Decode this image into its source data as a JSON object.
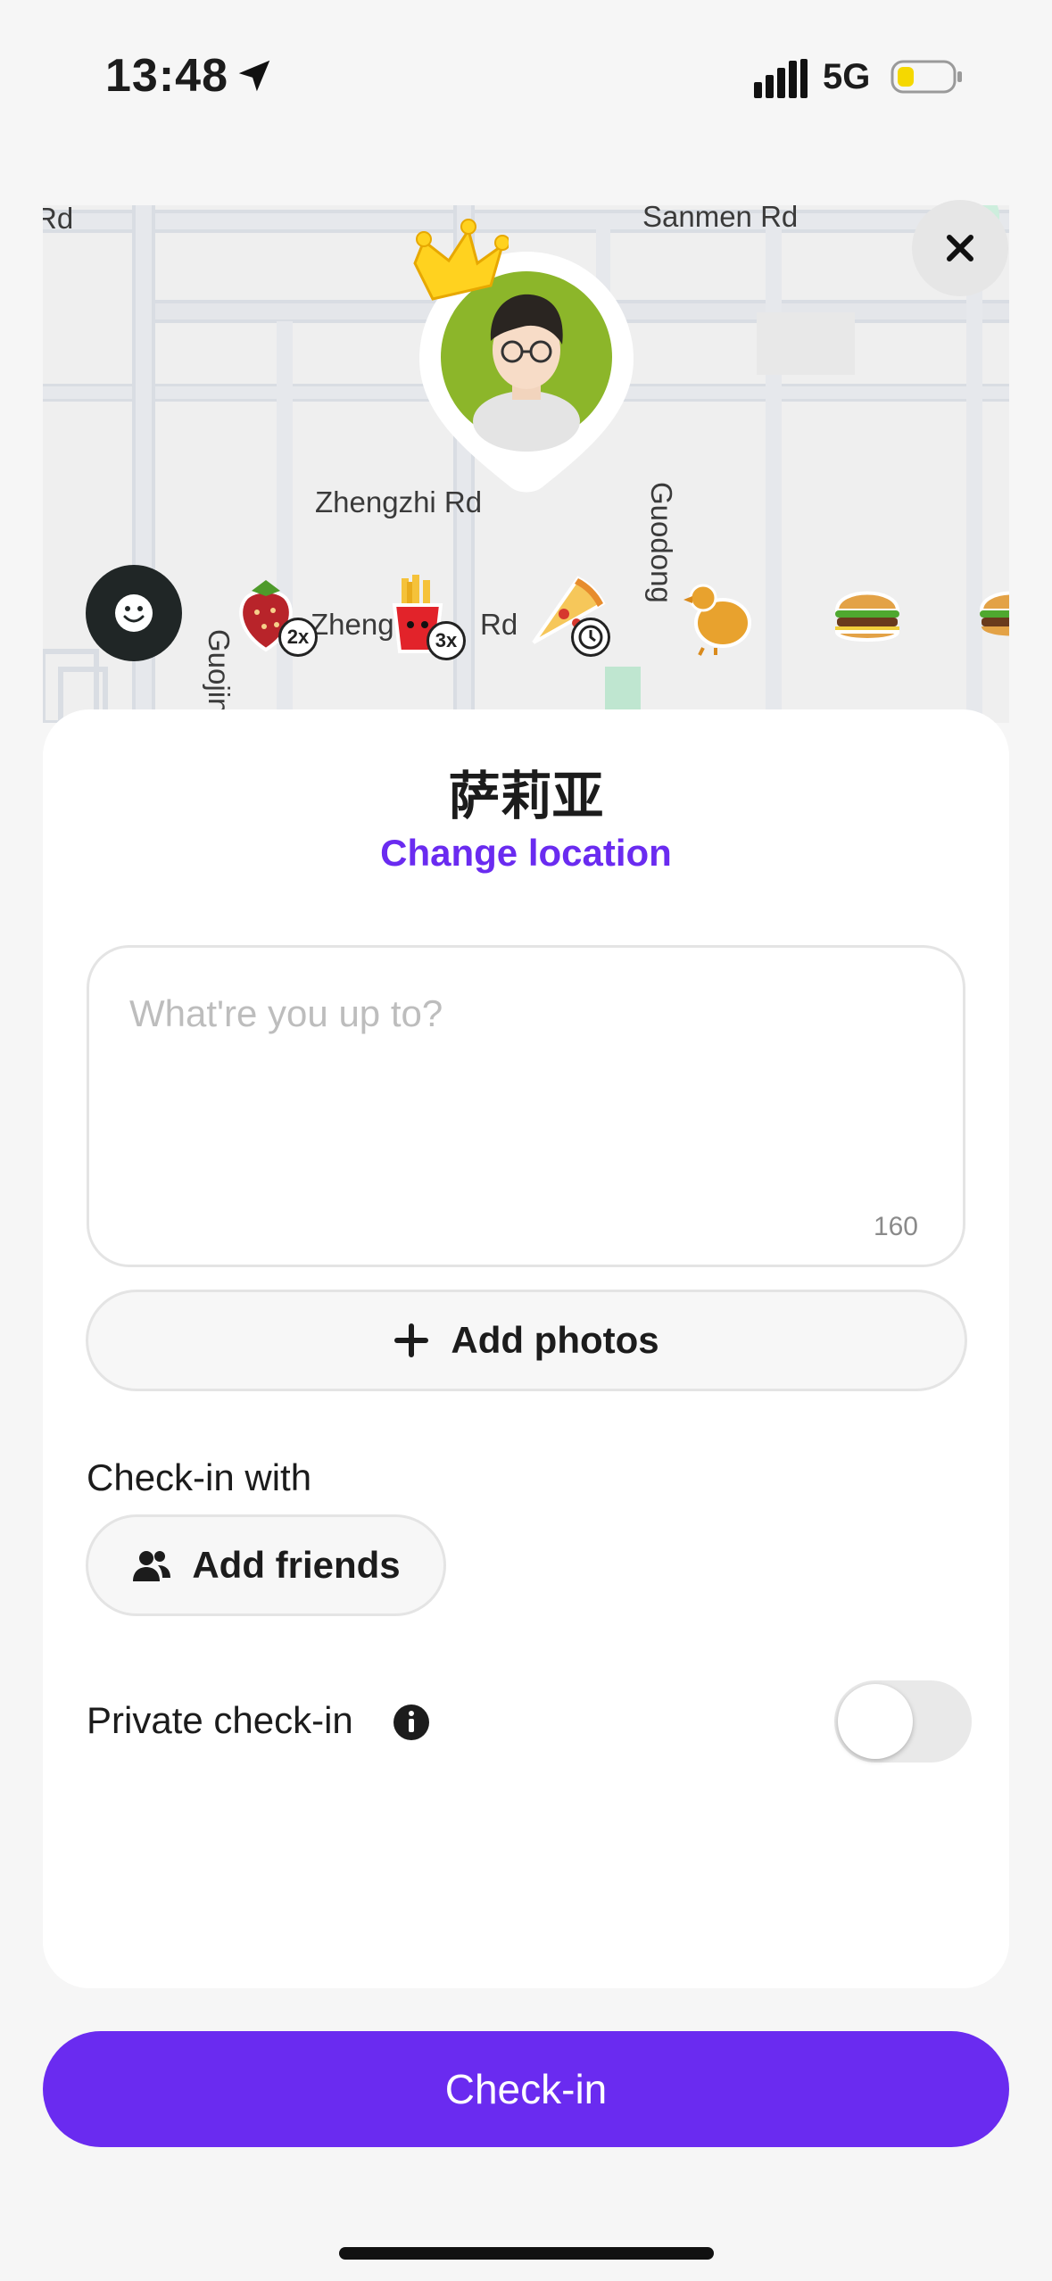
{
  "status_bar": {
    "time": "13:48",
    "network": "5G",
    "battery_color": "#f5d800"
  },
  "map": {
    "labels": {
      "rd_partial": "Rd",
      "sanmen": "Sanmen Rd",
      "zhengzhi": "Zhengzhi Rd",
      "guodong": "Guodong",
      "zheng_partial": "Zheng",
      "rd_partial2": "Rd",
      "guojin": "Guojin"
    },
    "food_items": [
      {
        "icon": "strawberry-icon",
        "badge": "2x"
      },
      {
        "icon": "fries-icon",
        "badge": "3x"
      },
      {
        "icon": "pizza-icon",
        "badge": "clock"
      },
      {
        "icon": "chicken-icon"
      },
      {
        "icon": "burger-icon"
      },
      {
        "icon": "burger-icon"
      }
    ]
  },
  "card": {
    "place_name": "萨莉亚",
    "change_location": "Change location",
    "input": {
      "placeholder": "What're you up to?",
      "value": "",
      "counter": "160"
    },
    "add_photos": "Add photos",
    "checkin_with_label": "Check-in with",
    "add_friends": "Add friends",
    "private_label": "Private check-in",
    "private_enabled": false
  },
  "checkin_button": "Check-in",
  "colors": {
    "accent": "#6a2bf0",
    "background": "#f6f6f6"
  }
}
